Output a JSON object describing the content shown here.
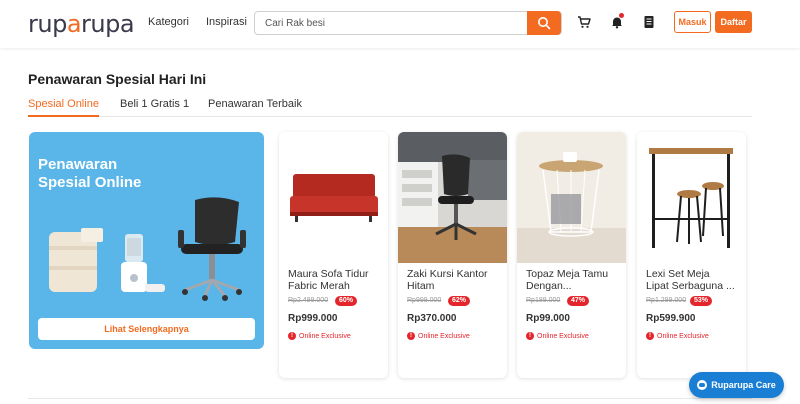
{
  "header": {
    "logo_left": "rup",
    "logo_accent": "a",
    "logo_right": "rupa",
    "nav": [
      "Kategori",
      "Inspirasi"
    ],
    "search_placeholder": "Cari Rak besi",
    "login_label": "Masuk",
    "register_label": "Daftar",
    "icons": [
      "search-icon",
      "cart-icon",
      "bell-icon",
      "receipt-icon"
    ]
  },
  "section": {
    "title": "Penawaran Spesial Hari Ini",
    "tabs": [
      {
        "label": "Spesial Online",
        "active": true
      },
      {
        "label": "Beli 1 Gratis 1",
        "active": false
      },
      {
        "label": "Penawaran Terbaik",
        "active": false
      }
    ]
  },
  "banner": {
    "title_line1": "Penawaran",
    "title_line2": "Spesial Online",
    "button_label": "Lihat Selengkapnya",
    "background": "#5ab6e9"
  },
  "products": [
    {
      "name_line1": "Maura Sofa Tidur",
      "name_line2": "Fabric Merah",
      "old_price": "Rp2.499.000",
      "discount": "60%",
      "price": "Rp999.000",
      "tag": "Online Exclusive"
    },
    {
      "name_line1": "Zaki Kursi Kantor",
      "name_line2": "Hitam",
      "old_price": "Rp999.000",
      "discount": "62%",
      "price": "Rp370.000",
      "tag": "Online Exclusive"
    },
    {
      "name_line1": "Topaz Meja Tamu",
      "name_line2": "Dengan...",
      "old_price": "Rp189.000",
      "discount": "47%",
      "price": "Rp99.000",
      "tag": "Online Exclusive"
    },
    {
      "name_line1": "Lexi Set Meja",
      "name_line2": "Lipat Serbaguna ...",
      "old_price": "Rp1.299.000",
      "discount": "53%",
      "price": "Rp599.900",
      "tag": "Online Exclusive"
    }
  ],
  "care_label": "Ruparupa Care",
  "colors": {
    "accent": "#f26b21",
    "discount": "#e4262c",
    "care": "#1a7fd4"
  }
}
